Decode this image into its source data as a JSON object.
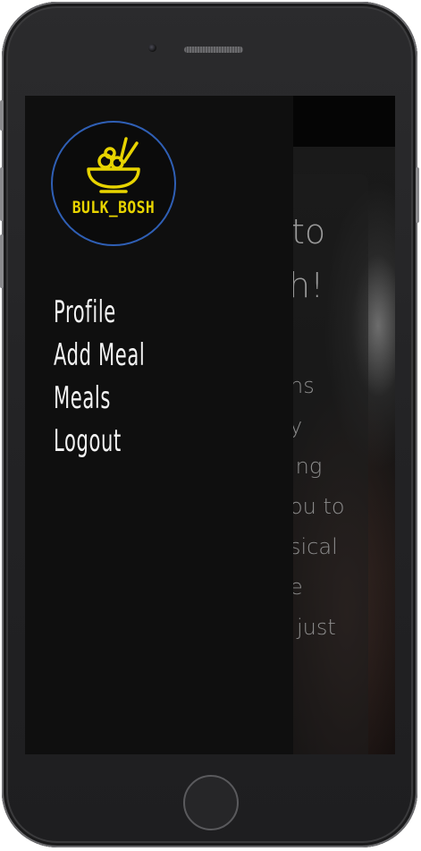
{
  "brand": {
    "logo_text": "BULK_BOSH",
    "accent_color": "#e8d400",
    "ring_color": "#2f5fb5"
  },
  "drawer": {
    "nav_items": [
      {
        "label": "Profile"
      },
      {
        "label": "Add Meal"
      },
      {
        "label": "Meals"
      },
      {
        "label": "Logout"
      }
    ]
  },
  "background_page": {
    "heading_line1": "to",
    "heading_line2": "h!",
    "body_lines": [
      "ns",
      "y",
      "ing",
      "ou to",
      "sical",
      "e",
      "just"
    ]
  }
}
